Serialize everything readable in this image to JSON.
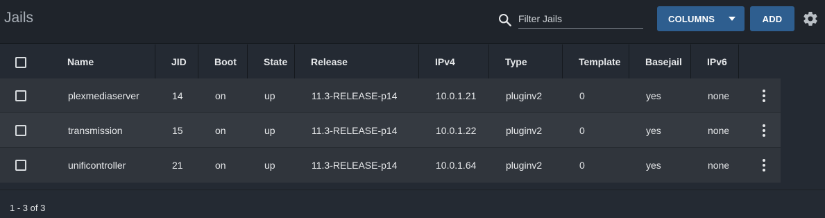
{
  "header": {
    "title": "Jails",
    "search": {
      "placeholder": "Filter Jails",
      "value": ""
    },
    "columns_label": "COLUMNS",
    "add_label": "ADD"
  },
  "table": {
    "columns": [
      "Name",
      "JID",
      "Boot",
      "State",
      "Release",
      "IPv4",
      "Type",
      "Template",
      "Basejail",
      "IPv6"
    ],
    "rows": [
      {
        "name": "plexmediaserver",
        "jid": "14",
        "boot": "on",
        "state": "up",
        "release": "11.3-RELEASE-p14",
        "ipv4": "10.0.1.21",
        "type": "pluginv2",
        "template": "0",
        "basejail": "yes",
        "ipv6": "none"
      },
      {
        "name": "transmission",
        "jid": "15",
        "boot": "on",
        "state": "up",
        "release": "11.3-RELEASE-p14",
        "ipv4": "10.0.1.22",
        "type": "pluginv2",
        "template": "0",
        "basejail": "yes",
        "ipv6": "none"
      },
      {
        "name": "unificontroller",
        "jid": "21",
        "boot": "on",
        "state": "up",
        "release": "11.3-RELEASE-p14",
        "ipv4": "10.0.1.64",
        "type": "pluginv2",
        "template": "0",
        "basejail": "yes",
        "ipv6": "none"
      }
    ]
  },
  "footer": {
    "pagination": "1 - 3 of 3"
  },
  "colors": {
    "accent": "#2e5e8f",
    "header_bg": "#1f242b",
    "row_bg": "#30353c",
    "row_alt_bg": "#353a41"
  },
  "icons": {
    "search": "search-icon",
    "settings": "gear-icon",
    "row_menu": "more-vert-icon",
    "dropdown": "caret-down-icon"
  }
}
